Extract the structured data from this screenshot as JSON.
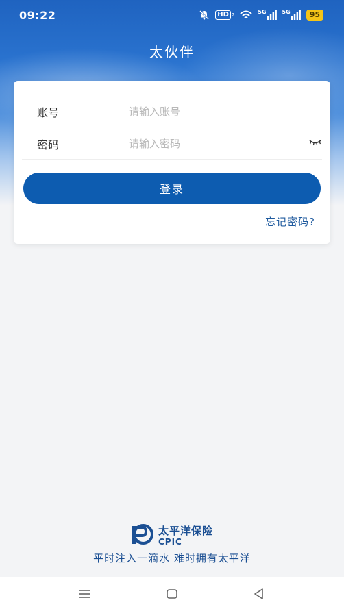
{
  "status_bar": {
    "time": "09:22",
    "hd_label": "HD",
    "hd_sub": "2",
    "net1": "5G",
    "net2": "5G",
    "battery": "95",
    "icons": [
      "bell-off-icon",
      "wifi-icon",
      "signal-icon",
      "signal-icon"
    ]
  },
  "header": {
    "title": "太伙伴"
  },
  "login": {
    "account_label": "账号",
    "account_placeholder": "请输入账号",
    "account_value": "",
    "password_label": "密码",
    "password_placeholder": "请输入密码",
    "password_value": "",
    "submit_label": "登录",
    "forgot_label": "忘记密码?"
  },
  "footer": {
    "brand_cn": "太平洋保险",
    "brand_en": "CPIC",
    "slogan": "平时注入一滴水 难时拥有太平洋"
  },
  "colors": {
    "primary": "#0d5cb0",
    "brand_text": "#1b4f93",
    "battery": "#f5c518"
  }
}
